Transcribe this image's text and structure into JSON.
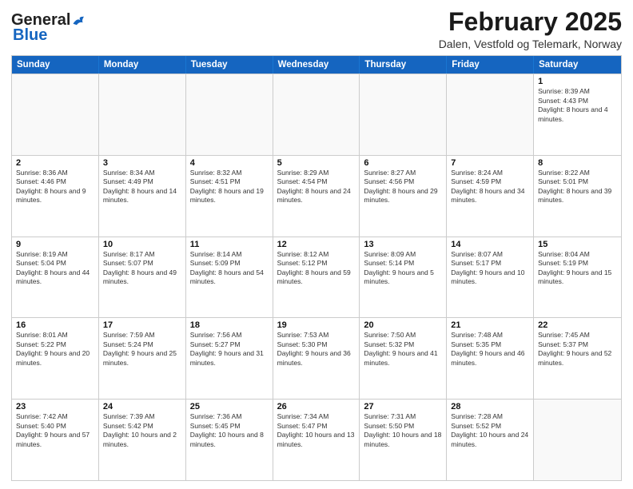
{
  "logo": {
    "general": "General",
    "blue": "Blue"
  },
  "title": "February 2025",
  "subtitle": "Dalen, Vestfold og Telemark, Norway",
  "headers": [
    "Sunday",
    "Monday",
    "Tuesday",
    "Wednesday",
    "Thursday",
    "Friday",
    "Saturday"
  ],
  "weeks": [
    [
      {
        "day": "",
        "text": "",
        "empty": true
      },
      {
        "day": "",
        "text": "",
        "empty": true
      },
      {
        "day": "",
        "text": "",
        "empty": true
      },
      {
        "day": "",
        "text": "",
        "empty": true
      },
      {
        "day": "",
        "text": "",
        "empty": true
      },
      {
        "day": "",
        "text": "",
        "empty": true
      },
      {
        "day": "1",
        "text": "Sunrise: 8:39 AM\nSunset: 4:43 PM\nDaylight: 8 hours and 4 minutes.",
        "empty": false
      }
    ],
    [
      {
        "day": "2",
        "text": "Sunrise: 8:36 AM\nSunset: 4:46 PM\nDaylight: 8 hours and 9 minutes.",
        "empty": false
      },
      {
        "day": "3",
        "text": "Sunrise: 8:34 AM\nSunset: 4:49 PM\nDaylight: 8 hours and 14 minutes.",
        "empty": false
      },
      {
        "day": "4",
        "text": "Sunrise: 8:32 AM\nSunset: 4:51 PM\nDaylight: 8 hours and 19 minutes.",
        "empty": false
      },
      {
        "day": "5",
        "text": "Sunrise: 8:29 AM\nSunset: 4:54 PM\nDaylight: 8 hours and 24 minutes.",
        "empty": false
      },
      {
        "day": "6",
        "text": "Sunrise: 8:27 AM\nSunset: 4:56 PM\nDaylight: 8 hours and 29 minutes.",
        "empty": false
      },
      {
        "day": "7",
        "text": "Sunrise: 8:24 AM\nSunset: 4:59 PM\nDaylight: 8 hours and 34 minutes.",
        "empty": false
      },
      {
        "day": "8",
        "text": "Sunrise: 8:22 AM\nSunset: 5:01 PM\nDaylight: 8 hours and 39 minutes.",
        "empty": false
      }
    ],
    [
      {
        "day": "9",
        "text": "Sunrise: 8:19 AM\nSunset: 5:04 PM\nDaylight: 8 hours and 44 minutes.",
        "empty": false
      },
      {
        "day": "10",
        "text": "Sunrise: 8:17 AM\nSunset: 5:07 PM\nDaylight: 8 hours and 49 minutes.",
        "empty": false
      },
      {
        "day": "11",
        "text": "Sunrise: 8:14 AM\nSunset: 5:09 PM\nDaylight: 8 hours and 54 minutes.",
        "empty": false
      },
      {
        "day": "12",
        "text": "Sunrise: 8:12 AM\nSunset: 5:12 PM\nDaylight: 8 hours and 59 minutes.",
        "empty": false
      },
      {
        "day": "13",
        "text": "Sunrise: 8:09 AM\nSunset: 5:14 PM\nDaylight: 9 hours and 5 minutes.",
        "empty": false
      },
      {
        "day": "14",
        "text": "Sunrise: 8:07 AM\nSunset: 5:17 PM\nDaylight: 9 hours and 10 minutes.",
        "empty": false
      },
      {
        "day": "15",
        "text": "Sunrise: 8:04 AM\nSunset: 5:19 PM\nDaylight: 9 hours and 15 minutes.",
        "empty": false
      }
    ],
    [
      {
        "day": "16",
        "text": "Sunrise: 8:01 AM\nSunset: 5:22 PM\nDaylight: 9 hours and 20 minutes.",
        "empty": false
      },
      {
        "day": "17",
        "text": "Sunrise: 7:59 AM\nSunset: 5:24 PM\nDaylight: 9 hours and 25 minutes.",
        "empty": false
      },
      {
        "day": "18",
        "text": "Sunrise: 7:56 AM\nSunset: 5:27 PM\nDaylight: 9 hours and 31 minutes.",
        "empty": false
      },
      {
        "day": "19",
        "text": "Sunrise: 7:53 AM\nSunset: 5:30 PM\nDaylight: 9 hours and 36 minutes.",
        "empty": false
      },
      {
        "day": "20",
        "text": "Sunrise: 7:50 AM\nSunset: 5:32 PM\nDaylight: 9 hours and 41 minutes.",
        "empty": false
      },
      {
        "day": "21",
        "text": "Sunrise: 7:48 AM\nSunset: 5:35 PM\nDaylight: 9 hours and 46 minutes.",
        "empty": false
      },
      {
        "day": "22",
        "text": "Sunrise: 7:45 AM\nSunset: 5:37 PM\nDaylight: 9 hours and 52 minutes.",
        "empty": false
      }
    ],
    [
      {
        "day": "23",
        "text": "Sunrise: 7:42 AM\nSunset: 5:40 PM\nDaylight: 9 hours and 57 minutes.",
        "empty": false
      },
      {
        "day": "24",
        "text": "Sunrise: 7:39 AM\nSunset: 5:42 PM\nDaylight: 10 hours and 2 minutes.",
        "empty": false
      },
      {
        "day": "25",
        "text": "Sunrise: 7:36 AM\nSunset: 5:45 PM\nDaylight: 10 hours and 8 minutes.",
        "empty": false
      },
      {
        "day": "26",
        "text": "Sunrise: 7:34 AM\nSunset: 5:47 PM\nDaylight: 10 hours and 13 minutes.",
        "empty": false
      },
      {
        "day": "27",
        "text": "Sunrise: 7:31 AM\nSunset: 5:50 PM\nDaylight: 10 hours and 18 minutes.",
        "empty": false
      },
      {
        "day": "28",
        "text": "Sunrise: 7:28 AM\nSunset: 5:52 PM\nDaylight: 10 hours and 24 minutes.",
        "empty": false
      },
      {
        "day": "",
        "text": "",
        "empty": true
      }
    ]
  ]
}
